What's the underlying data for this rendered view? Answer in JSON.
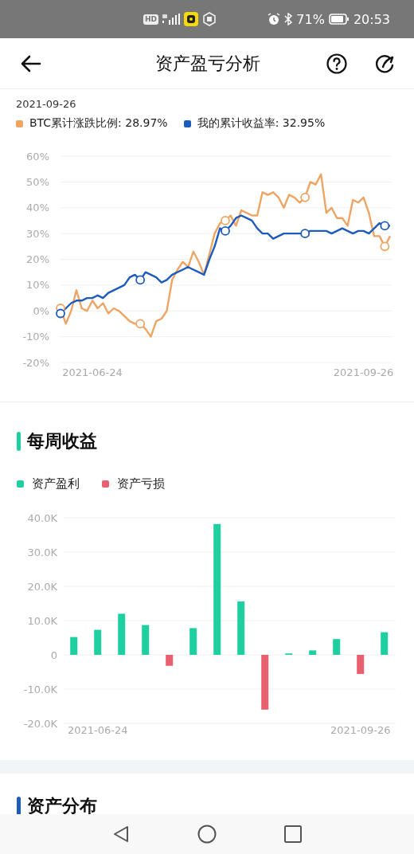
{
  "status_bar": {
    "badge": "HD",
    "battery": "71%",
    "time": "20:53"
  },
  "header": {
    "title": "资产盈亏分析"
  },
  "return_chart": {
    "date": "2021-09-26",
    "chart_data": {
      "type": "line",
      "grid": true,
      "categories": [
        null,
        null,
        null,
        null,
        null,
        null,
        "2021-06-24",
        null,
        null,
        null,
        null,
        null,
        null,
        null,
        null,
        null,
        null,
        null,
        null,
        null,
        null,
        null,
        null,
        null,
        null,
        null,
        null,
        null,
        null,
        null,
        null,
        null,
        null,
        null,
        null,
        null,
        null,
        null,
        null,
        null,
        null,
        null,
        null,
        null,
        null,
        null,
        null,
        null,
        null,
        null,
        null,
        null,
        null,
        null,
        null,
        null,
        null,
        "2021-09-26",
        null,
        null,
        null,
        null,
        null
      ],
      "ylim": [
        -20,
        60
      ],
      "yticks": [
        {
          "value": 60,
          "label": "60%"
        },
        {
          "value": 50,
          "label": "50%"
        },
        {
          "value": 40,
          "label": "40%"
        },
        {
          "value": 30,
          "label": "30%"
        },
        {
          "value": 20,
          "label": "20%"
        },
        {
          "value": 10,
          "label": "10%"
        },
        {
          "value": 0,
          "label": "0%"
        },
        {
          "value": -10,
          "label": "-10%"
        },
        {
          "value": -20,
          "label": "-20%"
        }
      ],
      "series": [
        {
          "name": "BTC累计涨跌比例: 28.97%",
          "color": "#eea462",
          "values": [
            1,
            -5,
            0,
            8,
            1,
            0,
            4,
            1,
            3,
            -1,
            1,
            0,
            -2,
            -4,
            -5,
            -5,
            -7,
            -10,
            -4,
            -3,
            0,
            12,
            16,
            19,
            17,
            23,
            19,
            14,
            22,
            30,
            34,
            35,
            37,
            33,
            39,
            38,
            37,
            37,
            46,
            45,
            46,
            44,
            40,
            45,
            44,
            42,
            44,
            50,
            49,
            53,
            38,
            40,
            36,
            36,
            33,
            43,
            42,
            44,
            38,
            29,
            29,
            25,
            29
          ]
        },
        {
          "name": "我的累计收益率: 32.95%",
          "color": "#1d5bbd",
          "values": [
            -1,
            1,
            3,
            4,
            4,
            5,
            5,
            6,
            5,
            7,
            8,
            9,
            10,
            13,
            14,
            12,
            15,
            14,
            13,
            11,
            12,
            14,
            15,
            16,
            17,
            16,
            15,
            14,
            20,
            25,
            32,
            31,
            33,
            36,
            37,
            36,
            35,
            32,
            30,
            30,
            28,
            29,
            30,
            30,
            30,
            30,
            30,
            31,
            31,
            31,
            31,
            30,
            31,
            32,
            31,
            30,
            31,
            31,
            30,
            32,
            34,
            33,
            33
          ]
        }
      ]
    }
  },
  "weekly": {
    "title": "每周收益",
    "chart_data": {
      "type": "bar",
      "grid": true,
      "categories": [
        null,
        "2021-06-24",
        null,
        null,
        null,
        null,
        null,
        null,
        null,
        null,
        null,
        null,
        "2021-09-26",
        null
      ],
      "ylim": [
        -20000,
        40000
      ],
      "yticks": [
        {
          "value": 40000,
          "label": "40.0K"
        },
        {
          "value": 30000,
          "label": "30.0K"
        },
        {
          "value": 20000,
          "label": "20.0K"
        },
        {
          "value": 10000,
          "label": "10.0K"
        },
        {
          "value": 0,
          "label": "0"
        },
        {
          "value": -10000,
          "label": "-10.0K"
        },
        {
          "value": -20000,
          "label": "-20.0K"
        }
      ],
      "series": [
        {
          "values": [
            5200,
            7300,
            12000,
            8700,
            -3200,
            7800,
            38200,
            15600,
            -16000,
            400,
            1300,
            4600,
            -5600,
            6600
          ]
        }
      ]
    },
    "legend": [
      {
        "label": "资产盈利",
        "color": "#1ecfa0"
      },
      {
        "label": "资产亏损",
        "color": "#e8606f"
      }
    ]
  },
  "distribution": {
    "title": "资产分布"
  }
}
